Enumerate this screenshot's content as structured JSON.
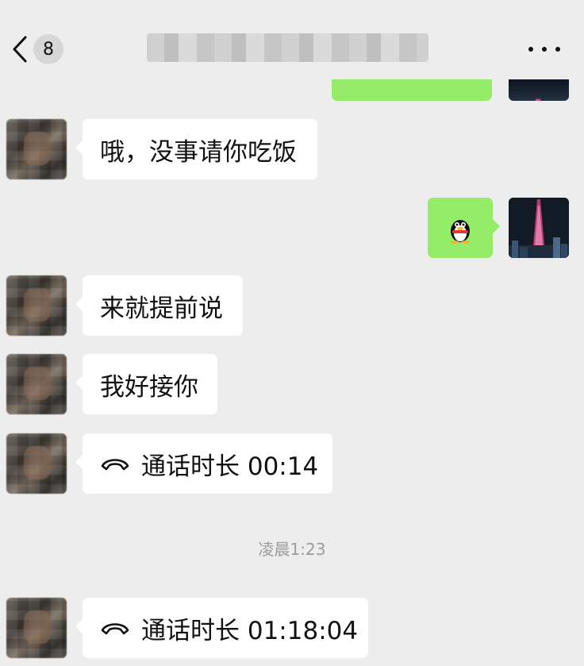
{
  "header": {
    "back_label": "back",
    "unread_count": "8",
    "more_label": "more"
  },
  "messages": [
    {
      "from": "other",
      "text": "哦，没事请你吃饭"
    },
    {
      "from": "self",
      "type": "sticker",
      "icon": "penguin-sticker-icon"
    },
    {
      "from": "other",
      "text": "来就提前说"
    },
    {
      "from": "other",
      "text": "我好接你"
    },
    {
      "from": "other",
      "type": "call",
      "text": "通话时长 00:14"
    },
    {
      "from": "other",
      "type": "call",
      "text": "通话时长 01:18:04"
    }
  ],
  "timestamp": "凌晨1:23",
  "colors": {
    "background": "#ededed",
    "outgoing_bubble": "#95ec69",
    "incoming_bubble": "#ffffff",
    "timestamp_text": "#9b9b9b"
  }
}
